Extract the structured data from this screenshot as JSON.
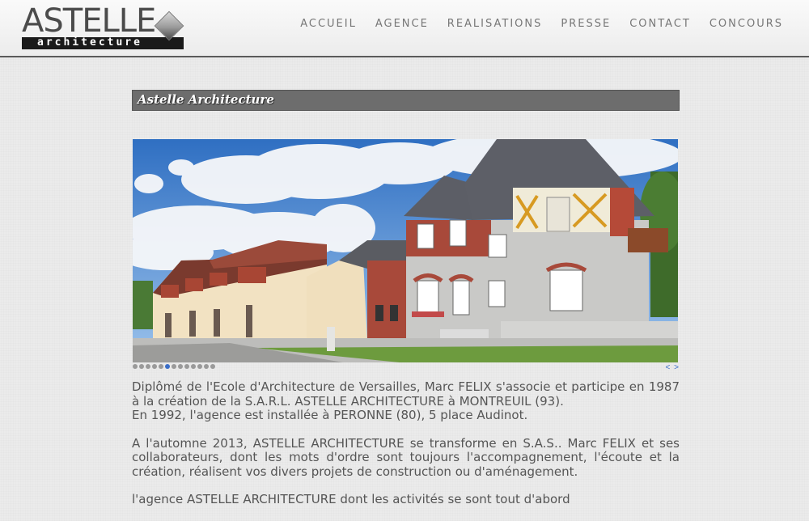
{
  "logo": {
    "name": "ASTELLE",
    "subtitle": "architecture"
  },
  "nav": [
    "ACCUEIL",
    "AGENCE",
    "REALISATIONS",
    "PRESSE",
    "CONTACT",
    "CONCOURS"
  ],
  "page": {
    "title": "Astelle Architecture"
  },
  "slider": {
    "dot_count": 13,
    "active_index": 5,
    "prev": "<",
    "next": ">"
  },
  "content": {
    "p1a": "Diplômé de l'Ecole d'Architecture de Versailles, Marc FELIX s'associe et participe en 1987 à la création de la S.A.R.L. ASTELLE ARCHITECTURE à MONTREUIL (93).",
    "p1b": "En 1992, l'agence est installée à PERONNE (80), 5 place Audinot.",
    "p2": "A l'automne 2013, ASTELLE ARCHITECTURE se transforme en S.A.S.. Marc FELIX et ses collaborateurs, dont les mots d'ordre sont toujours l'accompagnement, l'écoute et la création, réalisent vos divers projets de construction ou d'aménagement.",
    "p3": "l'agence ASTELLE ARCHITECTURE dont les activités se sont tout d'abord"
  }
}
